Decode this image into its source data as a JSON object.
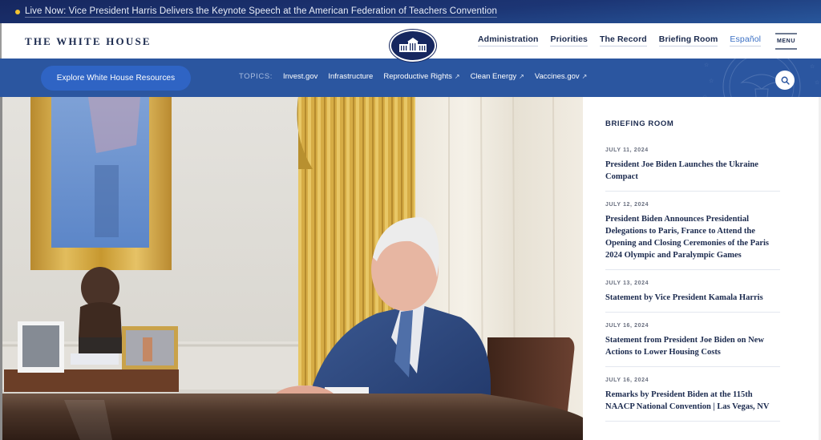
{
  "live_banner": {
    "indicator_color": "#f2c230",
    "text": "Live Now: Vice President Harris Delivers the Keynote Speech at the American Federation of Teachers Convention"
  },
  "header": {
    "wordmark": "THE WHITE HOUSE",
    "logo_icon": "white-house-seal-icon",
    "nav": [
      {
        "label": "Administration"
      },
      {
        "label": "Priorities"
      },
      {
        "label": "The Record"
      },
      {
        "label": "Briefing Room"
      },
      {
        "label": "Español"
      }
    ],
    "menu_label": "MENU"
  },
  "topics_bar": {
    "explore_label": "Explore White House Resources",
    "topics_label": "TOPICS:",
    "topics": [
      {
        "label": "Invest.gov",
        "external": false
      },
      {
        "label": "Infrastructure",
        "external": false
      },
      {
        "label": "Reproductive Rights",
        "external": true
      },
      {
        "label": "Clean Energy",
        "external": true
      },
      {
        "label": "Vaccines.gov",
        "external": true
      }
    ],
    "external_icon": "↗",
    "search_icon": "search-icon"
  },
  "hero": {
    "alt": "President Biden seated at the Resolute Desk in the Oval Office"
  },
  "briefing_room": {
    "title": "BRIEFING ROOM",
    "items": [
      {
        "date": "JULY 11, 2024",
        "headline": "President Joe Biden Launches the Ukraine Compact"
      },
      {
        "date": "JULY 12, 2024",
        "headline": "President Biden Announces Presidential Delegations to Paris, France to Attend the Opening and Closing Ceremonies of the Paris 2024 Olympic and Paralympic Games"
      },
      {
        "date": "JULY 13, 2024",
        "headline": "Statement by Vice President Kamala Harris"
      },
      {
        "date": "JULY 16, 2024",
        "headline": "Statement from President Joe Biden on New Actions to Lower Housing Costs"
      },
      {
        "date": "JULY 16, 2024",
        "headline": "Remarks by President Biden at the 115th NAACP National Convention | Las Vegas, NV"
      }
    ]
  },
  "colors": {
    "navy": "#1b2a4e",
    "topics_blue": "#2b56a0",
    "button_blue": "#2f64c4",
    "link_blue": "#3a6fc4"
  }
}
